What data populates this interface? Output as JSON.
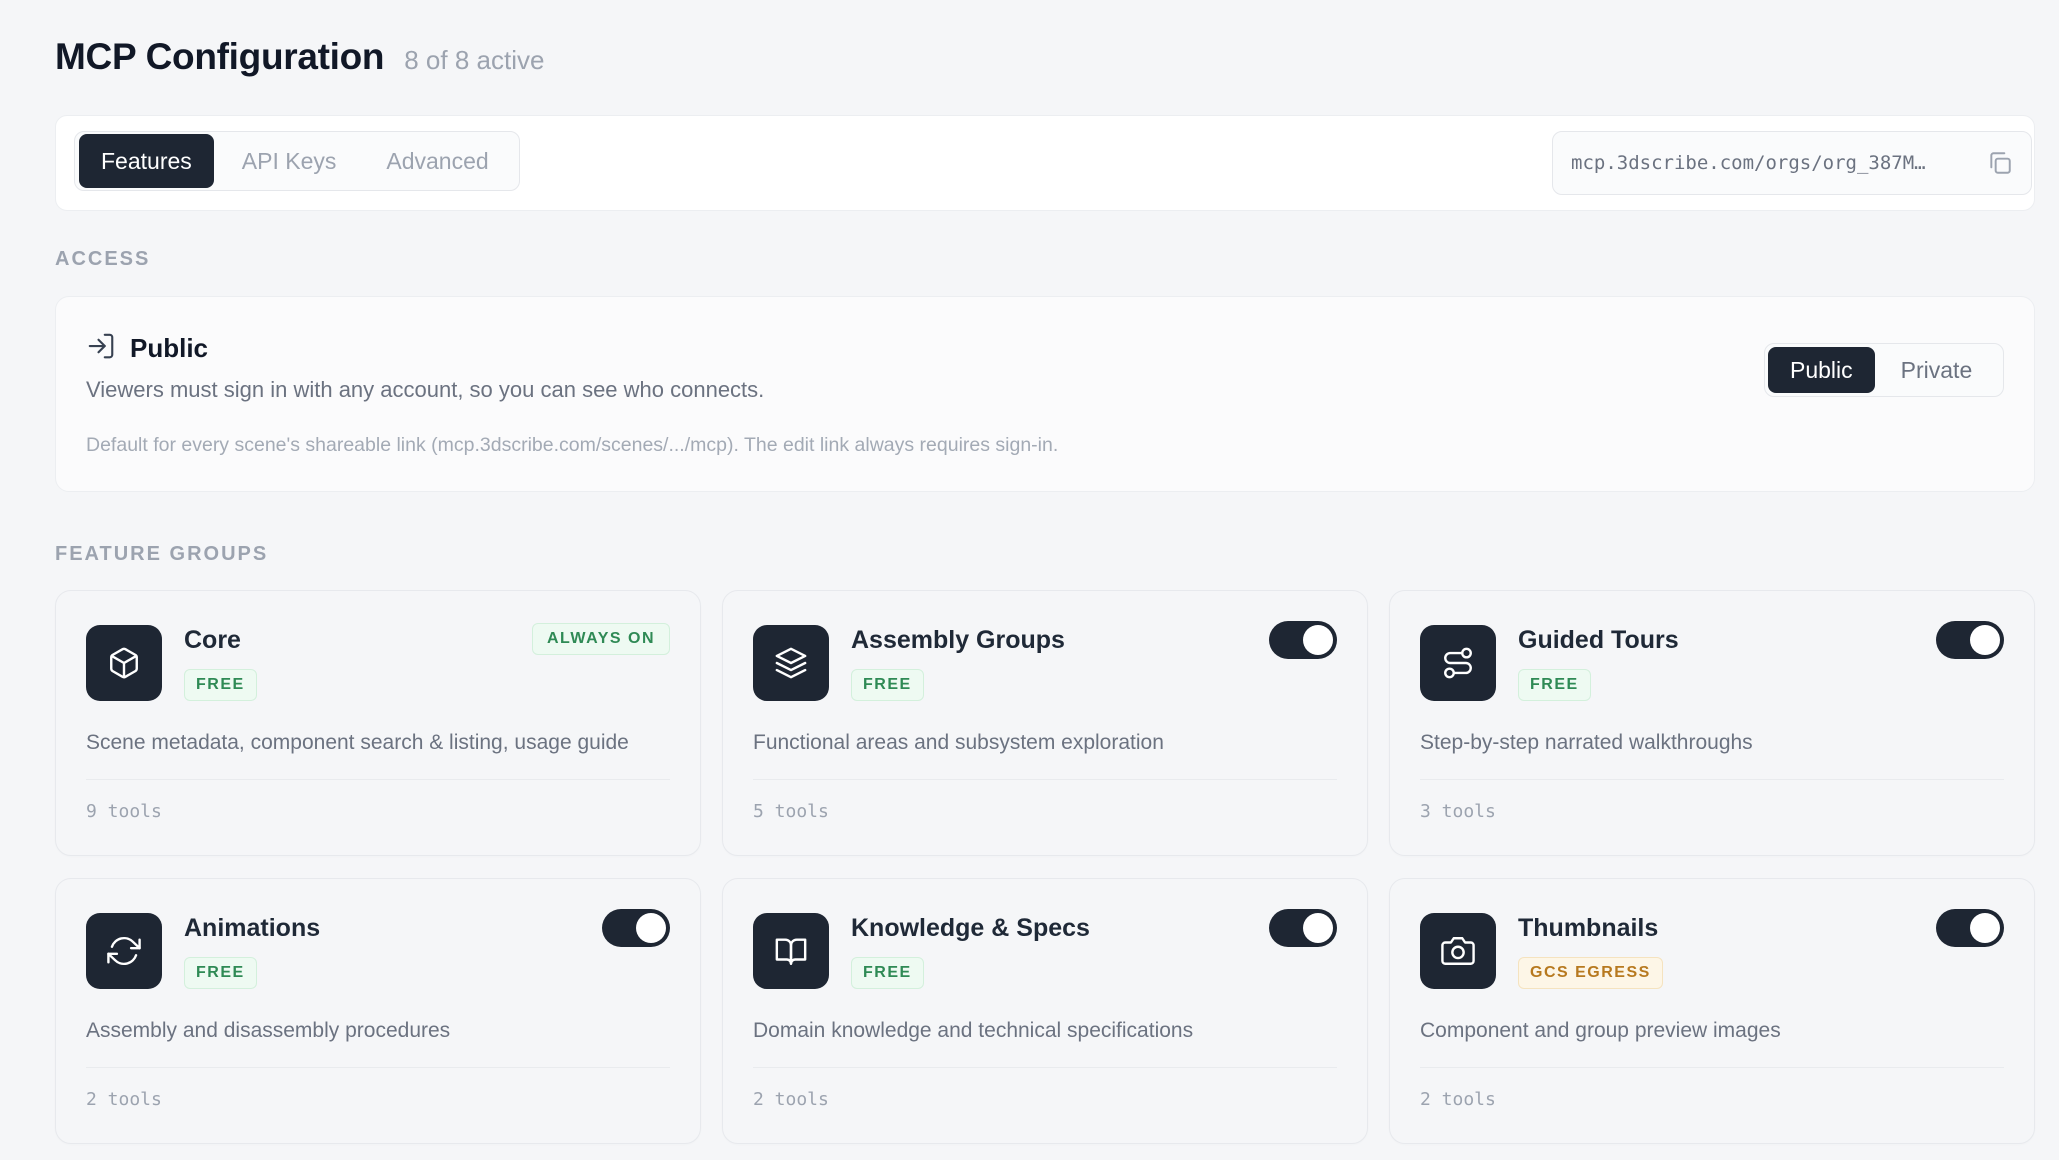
{
  "header": {
    "title": "MCP Configuration",
    "count": "8 of 8 active"
  },
  "tabs": [
    {
      "label": "Features",
      "active": true
    },
    {
      "label": "API Keys",
      "active": false
    },
    {
      "label": "Advanced",
      "active": false
    }
  ],
  "endpoint": {
    "url": "mcp.3dscribe.com/orgs/org_387M…",
    "icon": "copy-icon"
  },
  "access": {
    "section_label": "ACCESS",
    "icon": "sign-in-icon",
    "title": "Public",
    "description": "Viewers must sign in with any account, so you can see who connects.",
    "note": "Default for every scene's shareable link (mcp.3dscribe.com/scenes/.../mcp). The edit link always requires sign-in.",
    "options": [
      {
        "label": "Public",
        "active": true
      },
      {
        "label": "Private",
        "active": false
      }
    ]
  },
  "feature_groups": {
    "section_label": "FEATURE GROUPS",
    "items": [
      {
        "name": "Core",
        "icon": "cube-icon",
        "badge": "FREE",
        "badge_type": "free",
        "state": "always_on",
        "state_label": "ALWAYS ON",
        "description": "Scene metadata, component search & listing, usage guide",
        "tools": "9 tools"
      },
      {
        "name": "Assembly Groups",
        "icon": "layers-icon",
        "badge": "FREE",
        "badge_type": "free",
        "state": "on",
        "description": "Functional areas and subsystem exploration",
        "tools": "5 tools"
      },
      {
        "name": "Guided Tours",
        "icon": "route-icon",
        "badge": "FREE",
        "badge_type": "free",
        "state": "on",
        "description": "Step-by-step narrated walkthroughs",
        "tools": "3 tools"
      },
      {
        "name": "Animations",
        "icon": "refresh-icon",
        "badge": "FREE",
        "badge_type": "free",
        "state": "on",
        "description": "Assembly and disassembly procedures",
        "tools": "2 tools"
      },
      {
        "name": "Knowledge & Specs",
        "icon": "book-icon",
        "badge": "FREE",
        "badge_type": "free",
        "state": "on",
        "description": "Domain knowledge and technical specifications",
        "tools": "2 tools"
      },
      {
        "name": "Thumbnails",
        "icon": "camera-icon",
        "badge": "GCS EGRESS",
        "badge_type": "egress",
        "state": "on",
        "description": "Component and group preview images",
        "tools": "2 tools"
      }
    ]
  },
  "colors": {
    "dark": "#1e2633",
    "free_text": "#2f8a55",
    "egress_text": "#b7791f",
    "muted": "#9ca3af"
  }
}
